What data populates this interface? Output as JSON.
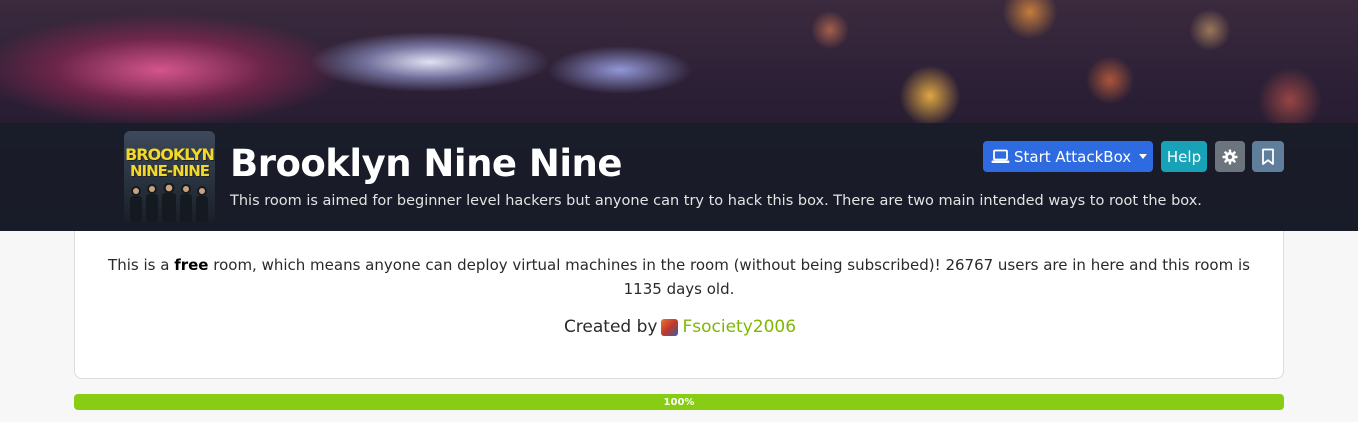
{
  "room": {
    "title": "Brooklyn Nine Nine",
    "description": "This room is aimed for beginner level hackers but anyone can try to hack this box. There are two main intended ways to root the box.",
    "thumbnail": {
      "line1": "BROOKLYN",
      "line2": "NINE-NINE"
    }
  },
  "toolbar": {
    "attackbox_label": "Start AttackBox",
    "help_label": "Help",
    "attackbox_icon": "laptop-icon",
    "settings_icon": "gear-icon",
    "bookmark_icon": "bookmark-icon"
  },
  "info": {
    "prefix": "This is a",
    "free": "free",
    "text": "room, which means anyone can deploy virtual machines in the room (without being subscribed)! 26767 users are in here and this room is 1135 days old.",
    "created_by_label": "Created by",
    "creator": "Fsociety2006"
  },
  "progress": {
    "value": 100,
    "label": "100%"
  },
  "colors": {
    "attackbox": "#2f6be0",
    "help": "#17a2b8",
    "settings": "#6c757d",
    "bookmark": "#5f7e9b",
    "progress": "#88cc14",
    "creator_link": "#7fb800"
  }
}
